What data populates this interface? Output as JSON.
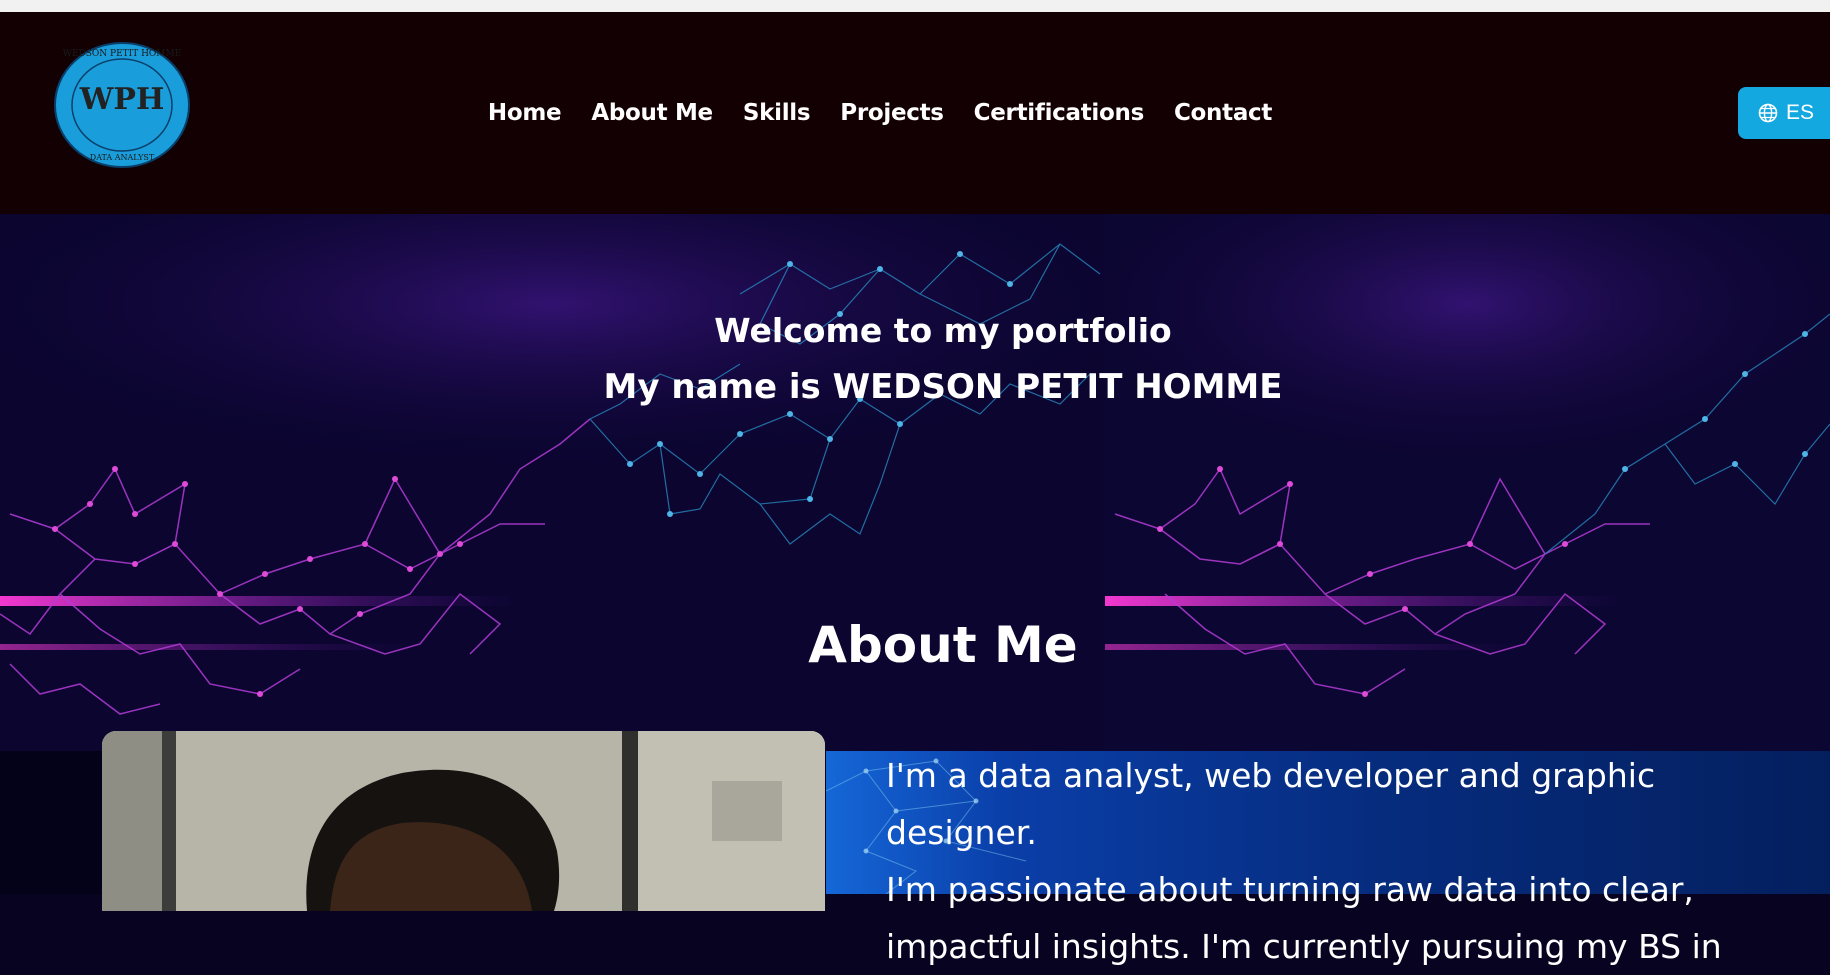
{
  "header": {
    "logo": {
      "name": "WEDSON PETIT HOMME",
      "monogram": "WPH",
      "tagline": "DATA ANALYST"
    },
    "nav": [
      {
        "label": "Home"
      },
      {
        "label": "About Me"
      },
      {
        "label": "Skills"
      },
      {
        "label": "Projects"
      },
      {
        "label": "Certifications"
      },
      {
        "label": "Contact"
      }
    ],
    "language_button": {
      "label": "ES",
      "icon": "globe-icon"
    }
  },
  "hero": {
    "welcome": "Welcome to my portfolio",
    "name_line": "My name is WEDSON PETIT HOMME"
  },
  "about": {
    "title": "About Me",
    "paragraph_lines": [
      "I'm a data analyst, web developer and graphic designer.",
      "I'm passionate about turning raw data into clear,",
      "impactful insights. I'm currently pursuing my BS in"
    ]
  },
  "colors": {
    "header_bg": "#130003",
    "accent": "#14a8e0",
    "hero_bg": "#09042a",
    "network_magenta": "#c23bd8",
    "network_cyan": "#3aa6d6"
  }
}
